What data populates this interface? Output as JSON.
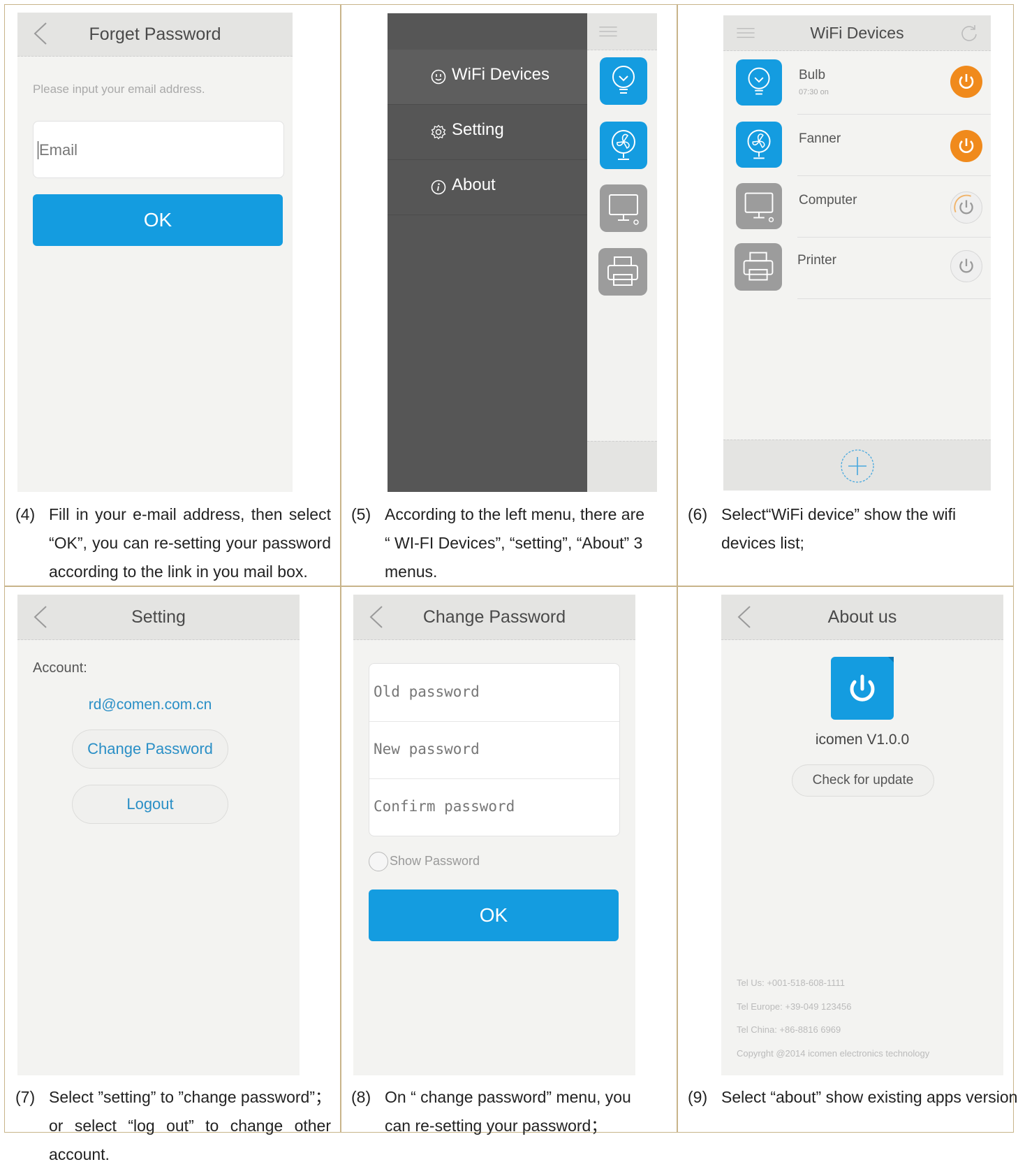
{
  "panel1": {
    "title": "Forget Password",
    "instruction": "Please input your email address.",
    "email_placeholder": "Email",
    "ok_label": "OK",
    "caption_num": "(4)",
    "caption_text": "Fill in your e-mail address, then select “OK”, you can re-setting your password according to the link in you mail box."
  },
  "panel2": {
    "menu": [
      {
        "icon": "plug-icon",
        "label": "WiFi Devices"
      },
      {
        "icon": "gear-icon",
        "label": "Setting"
      },
      {
        "icon": "info-icon",
        "label": "About"
      }
    ],
    "caption_num": "(5)",
    "caption_text": "According to the left menu, there are “ WI-FI Devices”, “setting”, “About” 3 menus."
  },
  "panel3": {
    "title": "WiFi Devices",
    "devices": [
      {
        "name": "Bulb",
        "sub": "07:30 on",
        "icon": "bulb-icon",
        "on": true
      },
      {
        "name": "Fanner",
        "sub": "",
        "icon": "fan-icon",
        "on": true
      },
      {
        "name": "Computer",
        "sub": "",
        "icon": "computer-icon",
        "on": false
      },
      {
        "name": "Printer",
        "sub": "",
        "icon": "printer-icon",
        "on": false
      }
    ],
    "caption_num": "(6)",
    "caption_text": "Select“WiFi device” show the wifi devices list;"
  },
  "panel4": {
    "title": "Setting",
    "account_label": "Account:",
    "account_email": "rd@comen.com.cn",
    "change_password_label": "Change Password",
    "logout_label": "Logout",
    "caption_num": "(7)",
    "caption_text": "Select ”setting” to ”change password”；or select “log out” to change other account."
  },
  "panel5": {
    "title": "Change Password",
    "old_placeholder": "Old password",
    "new_placeholder": "New password",
    "confirm_placeholder": "Confirm password",
    "show_password_label": "Show Password",
    "ok_label": "OK",
    "caption_num": "(8)",
    "caption_text": "On “ change password” menu, you can re-setting your password；"
  },
  "panel6": {
    "title": "About us",
    "version": "icomen V1.0.0",
    "check_update_label": "Check for update",
    "tel_us": "Tel Us: +001-518-608-1111",
    "tel_europe": "Tel Europe: +39-049 123456",
    "tel_china": "Tel China: +86-8816 6969",
    "copyright": "Copyrght @2014 icomen electronics technology",
    "caption_num": "(9)",
    "caption_text": "Select “about” show existing apps version"
  },
  "colors": {
    "accent_blue": "#149ce0",
    "power_orange": "#f08a1c",
    "menu_dark": "#565656",
    "border_gold": "#c8b48a"
  }
}
